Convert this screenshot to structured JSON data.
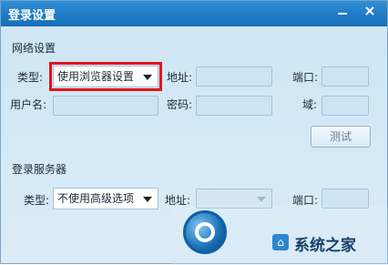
{
  "window": {
    "title": "登录设置",
    "minimize_icon": "minimize-icon",
    "close_icon": "close-icon"
  },
  "network": {
    "section_title": "网络设置",
    "type_label": "类型:",
    "type_value": "使用浏览器设置",
    "address_label": "地址:",
    "port_label": "端口:",
    "username_label": "用户名:",
    "password_label": "密码:",
    "domain_label": "域:",
    "test_button": "测试"
  },
  "login_server": {
    "section_title": "登录服务器",
    "type_label": "类型:",
    "type_value": "不使用高级选项",
    "address_label": "地址:",
    "port_label": "端口:"
  },
  "watermark": {
    "text": "系统之家"
  },
  "colors": {
    "titlebar": "#1f79c4",
    "highlight": "#e2141d",
    "input_bg": "#cfe4f3"
  }
}
